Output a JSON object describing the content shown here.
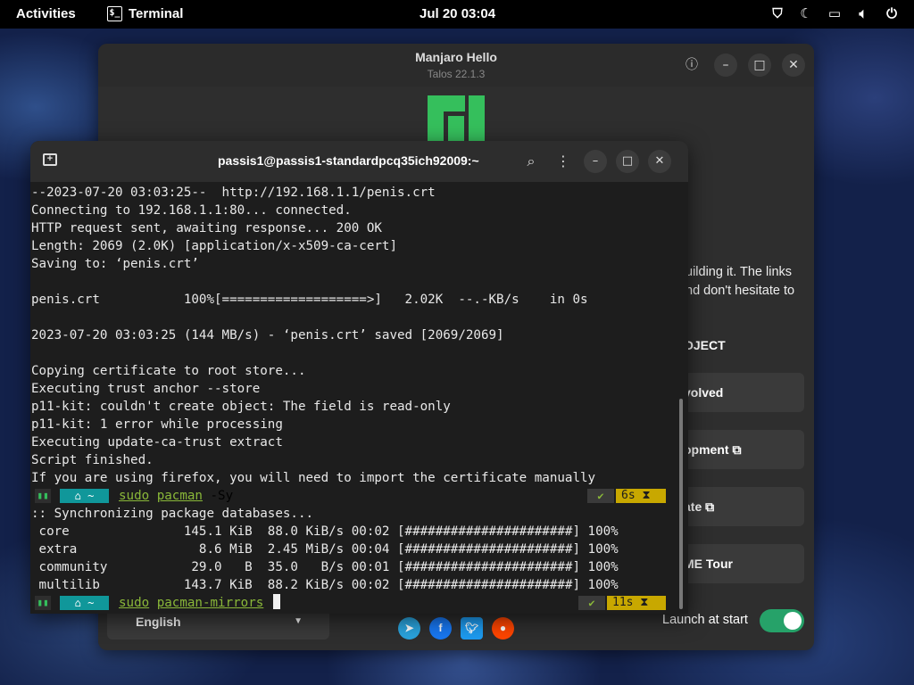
{
  "topbar": {
    "activities": "Activities",
    "app_name": "Terminal",
    "clock": "Jul 20  03:04",
    "tray_icons": [
      "shield-icon",
      "moon-icon",
      "keyboard-icon",
      "volume-icon",
      "power-icon"
    ]
  },
  "hello": {
    "title": "Manjaro Hello",
    "subtitle": "Talos 22.1.3",
    "desc_line1": "uilding it. The links",
    "desc_line2": "nd don't hesitate to",
    "section": "OJECT",
    "buttons": [
      "volved",
      "opment ⧉",
      "ate ⧉",
      "ME Tour"
    ],
    "language": "English",
    "launch_label": "Launch at start",
    "launch_on": true,
    "social_icons": [
      "telegram-icon",
      "facebook-icon",
      "twitter-icon",
      "reddit-icon"
    ],
    "colors": {
      "logo": "#35bf5c",
      "toggle": "#26a269"
    }
  },
  "terminal": {
    "title": "passis1@passis1-standardpcq35ich92009:~",
    "lines": [
      "--2023-07-20 03:03:25--  http://192.168.1.1/penis.crt",
      "Connecting to 192.168.1.1:80... connected.",
      "HTTP request sent, awaiting response... 200 OK",
      "Length: 2069 (2.0K) [application/x-x509-ca-cert]",
      "Saving to: ‘penis.crt’",
      "",
      "penis.crt           100%[===================>]   2.02K  --.-KB/s    in 0s",
      "",
      "2023-07-20 03:03:25 (144 MB/s) - ‘penis.crt’ saved [2069/2069]",
      "",
      "Copying certificate to root store...",
      "Executing trust anchor --store",
      "p11-kit: couldn't create object: The field is read-only",
      "p11-kit: 1 error while processing",
      "Executing update-ca-trust extract",
      "Script finished.",
      "If you are using firefox, you will need to import the certificate manually"
    ],
    "prompt1": {
      "home": "⌂ ~",
      "cmd_kw": "sudo",
      "cmd_a": "pacman",
      "cmd_rest": " -Sy",
      "ok": "✔",
      "time": "6s ⧗"
    },
    "sync_lines": [
      ":: Synchronizing package databases...",
      " core               145.1 KiB  88.0 KiB/s 00:02 [######################] 100%",
      " extra                8.6 MiB  2.45 MiB/s 00:04 [######################] 100%",
      " community           29.0   B  35.0   B/s 00:01 [######################] 100%",
      " multilib           143.7 KiB  88.2 KiB/s 00:02 [######################] 100%"
    ],
    "prompt2": {
      "home": "⌂ ~",
      "cmd_kw": "sudo",
      "cmd_a": "pacman-mirrors",
      "ok": "✔",
      "time": "11s ⧗"
    }
  }
}
